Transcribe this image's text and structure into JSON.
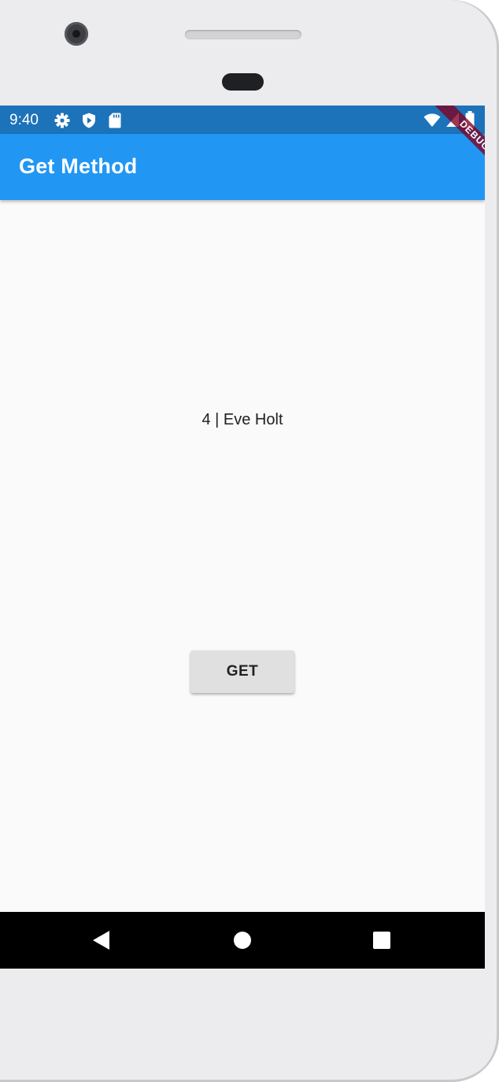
{
  "status_bar": {
    "time": "9:40",
    "left_icons": [
      "settings-icon",
      "shield-play-icon",
      "sd-card-icon"
    ],
    "right_icons": [
      "wifi-icon",
      "cell-signal-icon",
      "battery-icon"
    ],
    "background": "#1c73b9"
  },
  "app_bar": {
    "title": "Get Method",
    "background": "#2196f3"
  },
  "debug_banner": {
    "label": "DEBUG"
  },
  "body": {
    "result_text": "4 | Eve Holt"
  },
  "actions": {
    "get_label": "GET"
  },
  "nav_bar": {
    "buttons": [
      "back-icon",
      "home-icon",
      "recents-icon"
    ]
  }
}
